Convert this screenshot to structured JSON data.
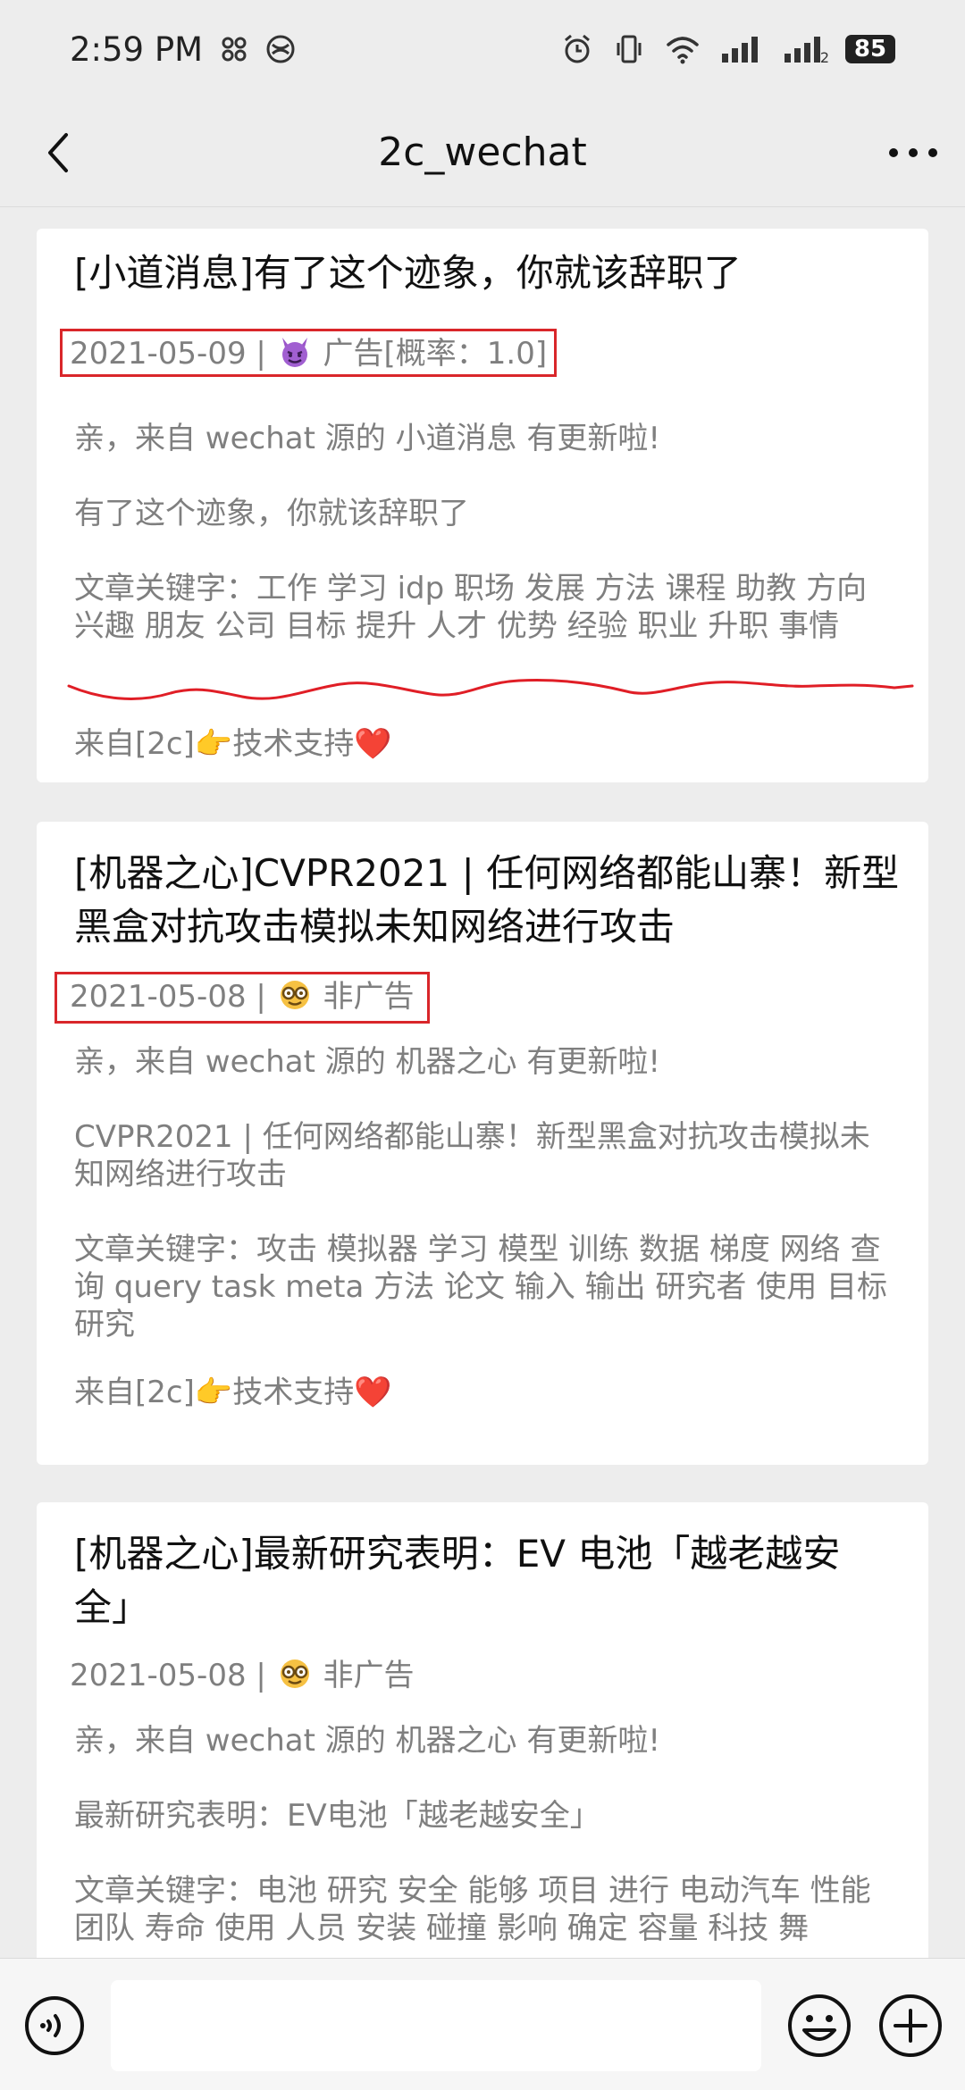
{
  "status_bar": {
    "time": "2:59 PM",
    "battery": "85",
    "sim_label": "2"
  },
  "nav": {
    "title": "2c_wechat"
  },
  "cards": [
    {
      "title": "[小道消息]有了这个迹象，你就该辞职了",
      "date": "2021-05-09",
      "separator": "|",
      "tag": "广告[概率：1.0]",
      "greeting": "亲，来自 wechat 源的 小道消息 有更新啦!",
      "summary": "有了这个迹象，你就该辞职了",
      "keywords": "文章关键字：工作 学习 idp 职场 发展 方法 课程 助教 方向 兴趣 朋友 公司 目标 提升 人才 优势 经验 职业 升职 事情",
      "footer": "来自[2c]👉技术支持❤️"
    },
    {
      "title": "[机器之心]CVPR2021 | 任何网络都能山寨！新型黑盒对抗攻击模拟未知网络进行攻击",
      "date": "2021-05-08",
      "separator": "|",
      "tag": "非广告",
      "greeting": "亲，来自 wechat 源的 机器之心 有更新啦!",
      "summary": "CVPR2021 | 任何网络都能山寨！新型黑盒对抗攻击模拟未知网络进行攻击",
      "keywords": "文章关键字：攻击 模拟器 学习 模型 训练 数据 梯度 网络 查询 query task meta 方法 论文 输入 输出 研究者 使用 目标 研究",
      "footer": "来自[2c]👉技术支持❤️"
    },
    {
      "title": "[机器之心]最新研究表明：EV 电池「越老越安全」",
      "date": "2021-05-08",
      "separator": "|",
      "tag": "非广告",
      "greeting": "亲，来自 wechat 源的 机器之心 有更新啦!",
      "summary": "最新研究表明：EV电池「越老越安全」",
      "keywords": "文章关键字：电池 研究 安全 能够 项目 进行 电动汽车 性能 团队 寿命 使用 人员 安装 碰撞 影响 确定 容量 科技 舞"
    }
  ],
  "input_bar": {
    "placeholder": ""
  }
}
